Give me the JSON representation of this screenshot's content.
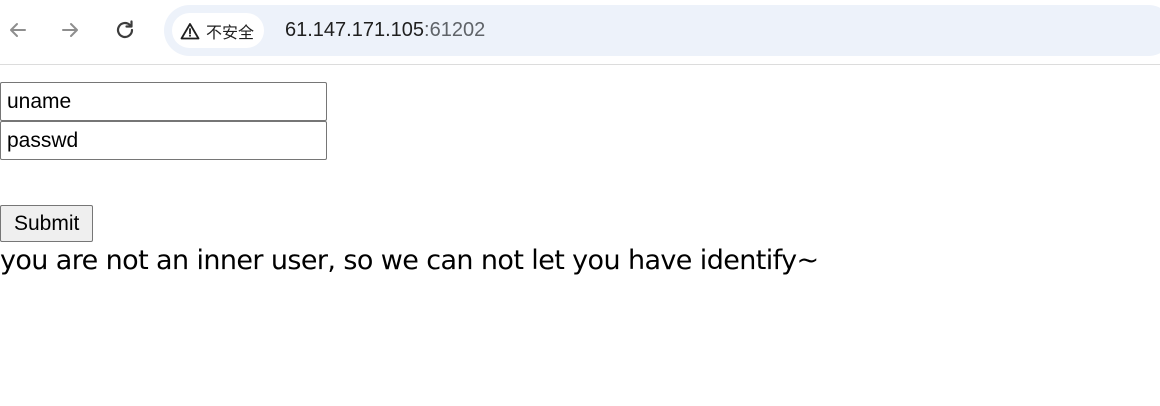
{
  "browser": {
    "security_label": "不安全",
    "url_host": "61.147.171.105",
    "url_port": ":61202",
    "icons": [
      "back-arrow-icon",
      "forward-arrow-icon",
      "reload-icon",
      "warning-triangle-icon"
    ]
  },
  "form": {
    "uname_value": "uname",
    "passwd_value": "passwd",
    "submit_label": "Submit"
  },
  "message": "you are not an inner user, so we can not let you have identify~"
}
